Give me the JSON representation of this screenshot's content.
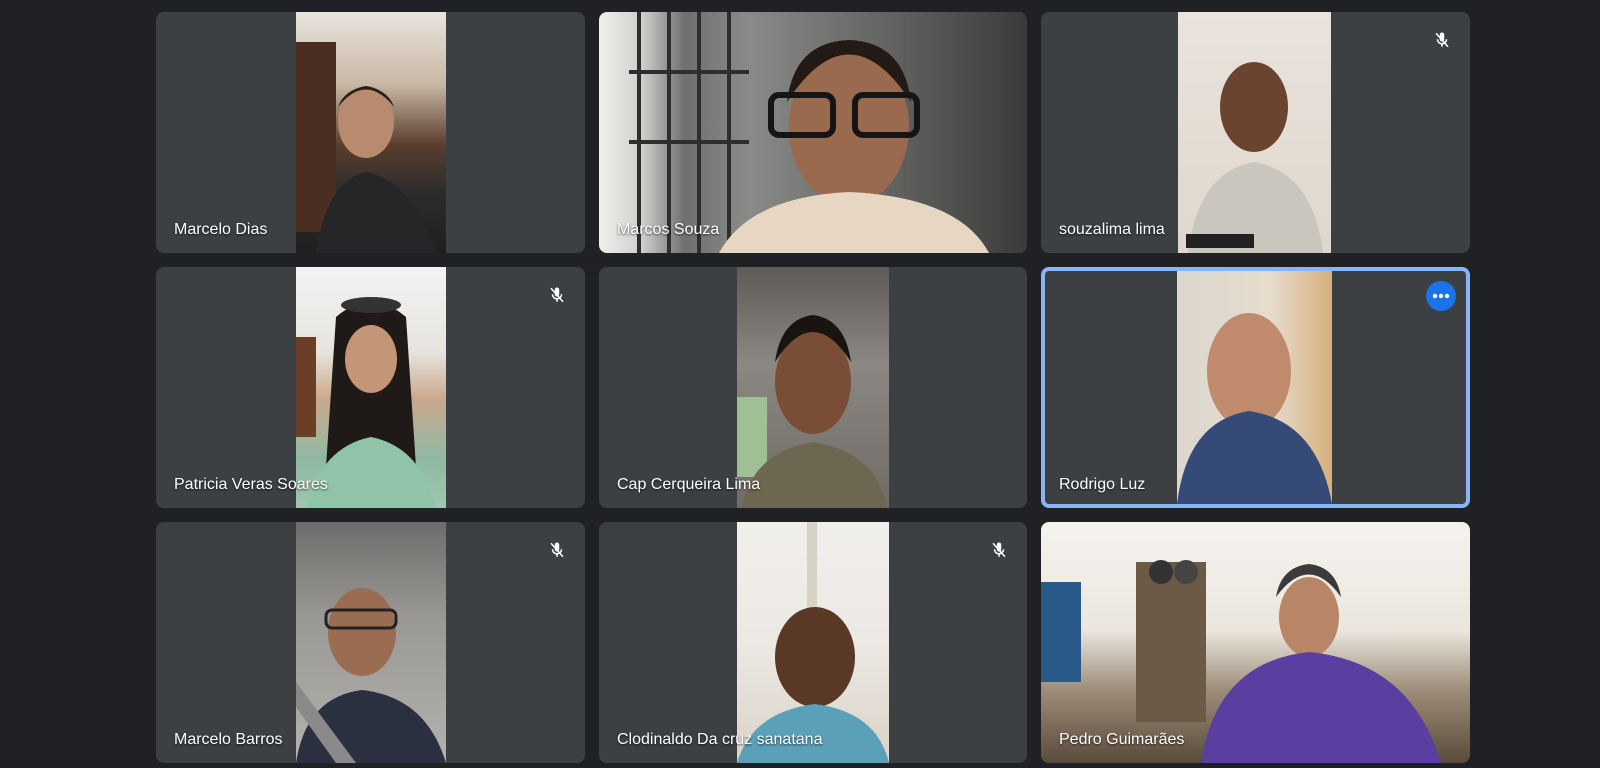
{
  "participants": [
    {
      "name": "Marcelo Dias",
      "muted": false
    },
    {
      "name": "Marcos Souza",
      "muted": false
    },
    {
      "name": "souzalima lima",
      "muted": true
    },
    {
      "name": "Patricia Veras Soares",
      "muted": true
    },
    {
      "name": "Cap Cerqueira Lima",
      "muted": false
    },
    {
      "name": "Rodrigo Luz",
      "muted": false,
      "speaking": true
    },
    {
      "name": "Marcelo Barros",
      "muted": true
    },
    {
      "name": "Clodinaldo Da cruz sanatana",
      "muted": true
    },
    {
      "name": "Pedro Guimarães",
      "muted": false
    }
  ],
  "icons": {
    "mic_off": "mic-off-icon",
    "more": "more-options-icon"
  },
  "colors": {
    "background": "#202124",
    "tile": "#3c4043",
    "active_border": "#8ab4f8",
    "accent": "#1a73e8"
  }
}
